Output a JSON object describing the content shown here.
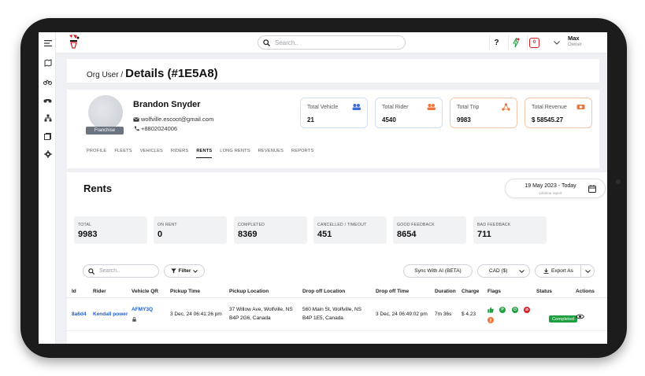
{
  "topbar": {
    "search_placeholder": "Search..",
    "help_label": "?",
    "notif_count": "0",
    "user_name": "Max",
    "user_role": "Owner"
  },
  "breadcrumb": {
    "parent": "Org User /",
    "current": "Details (#1E5A8)"
  },
  "profile": {
    "name": "Brandon Snyder",
    "email": "wolfville.escoot@gmail.com",
    "phone": "+8802024006",
    "badge": "Franchise"
  },
  "stats": [
    {
      "label": "Total Vehicle",
      "value": "21",
      "color": "#3b6fd4"
    },
    {
      "label": "Total Rider",
      "value": "4540",
      "color": "#f0753a"
    },
    {
      "label": "Total Trip",
      "value": "9983",
      "color": "#f0753a"
    },
    {
      "label": "Total Revenue",
      "value": "$ 58545.27",
      "color": "#f0753a"
    }
  ],
  "tabs": [
    "PROFILE",
    "FLEETS",
    "VEHICLES",
    "RIDERS",
    "RENTS",
    "LONG RENTS",
    "REVENUES",
    "REPORTS"
  ],
  "rents": {
    "title": "Rents",
    "date_range": "19 May 2023 - Today",
    "date_sub": "Lifetime report",
    "summary": [
      {
        "label": "TOTAL",
        "value": "9983"
      },
      {
        "label": "ON RENT",
        "value": "0"
      },
      {
        "label": "COMPLETED",
        "value": "8369"
      },
      {
        "label": "CANCELLED / TIMEOUT",
        "value": "451"
      },
      {
        "label": "GOOD FEEDBACK",
        "value": "8654"
      },
      {
        "label": "BAD FEEDBACK",
        "value": "711"
      }
    ],
    "search_placeholder": "Search..",
    "filter_label": "Filter",
    "sync_label": "Sync With AI (BETA)",
    "currency_label": "CAD ($)",
    "export_label": "Export As"
  },
  "table": {
    "headers": [
      "Id",
      "Rider",
      "Vehicle QR",
      "Pickup Time",
      "Pickup Location",
      "Drop off Location",
      "Drop off Time",
      "Duration",
      "Charge",
      "Flags",
      "Status",
      "Actions"
    ],
    "rows": [
      {
        "id": "8a6d4",
        "rider": "Kendall power",
        "vehicle_qr": "AFMY3Q",
        "pickup_time": "3 Dec, 24 06:41:26 pm",
        "pickup_loc_1": "37 Willow Ave, Wolfville, NS",
        "pickup_loc_2": "B4P 2G6, Canada",
        "drop_loc_1": "560 Main St, Wolfville, NS",
        "drop_loc_2": "B4P 1E5, Canada",
        "drop_time": "3 Dec, 24 06:49:02 pm",
        "duration": "7m 36s",
        "charge": "$ 4.23",
        "flags": [
          "P",
          "O",
          "⊘"
        ],
        "status": "Completed"
      }
    ]
  }
}
